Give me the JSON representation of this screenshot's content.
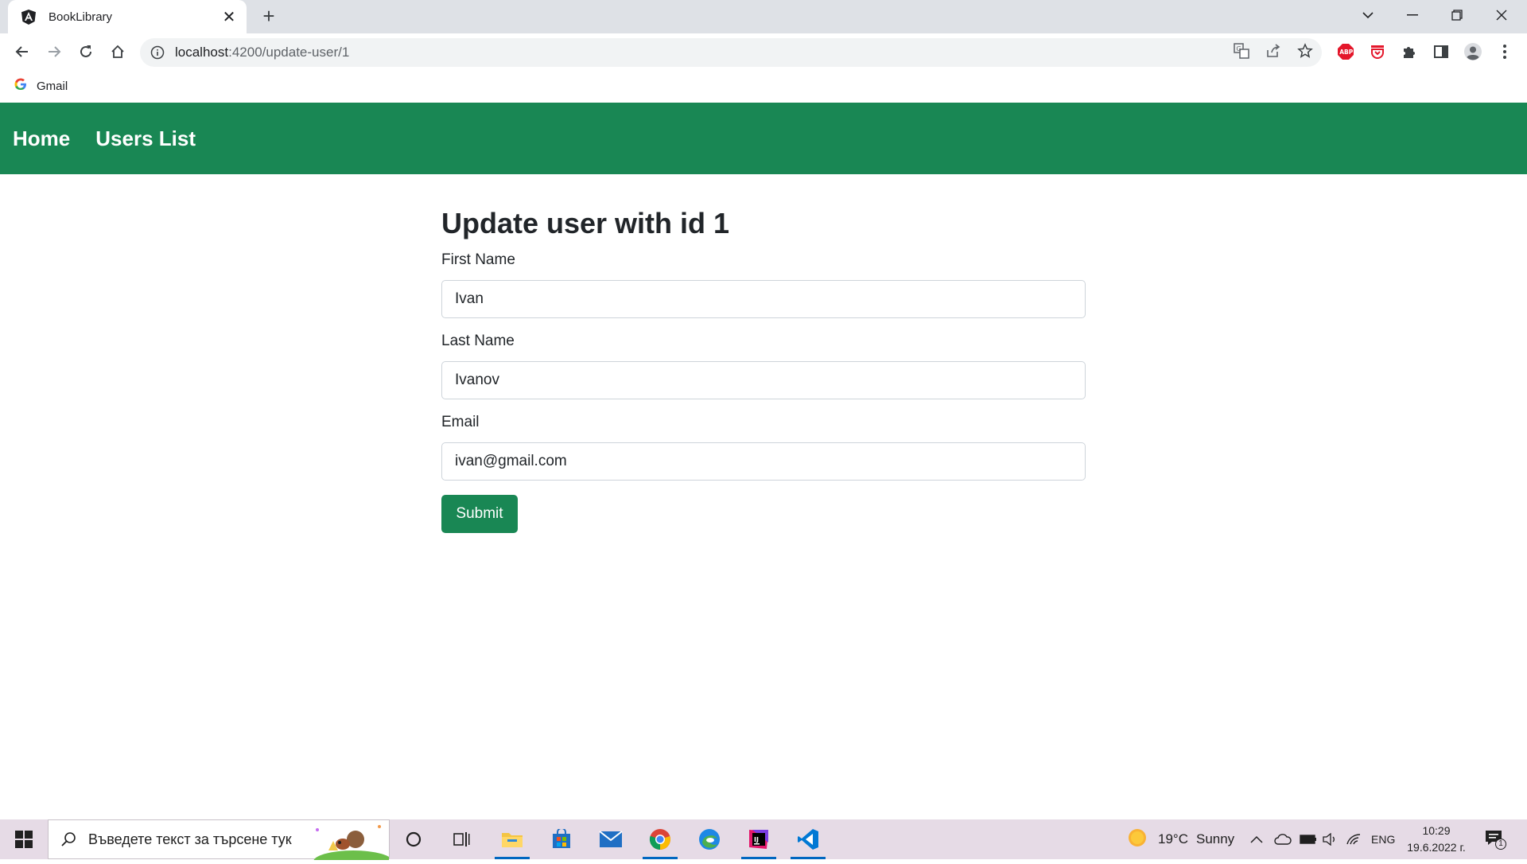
{
  "browser": {
    "tab": {
      "title": "BookLibrary",
      "close_glyph": "✕"
    },
    "newtab_glyph": "+",
    "address": {
      "host": "localhost",
      "path": ":4200/update-user/1"
    },
    "bookmarks": [
      {
        "label": "Gmail"
      }
    ]
  },
  "navbar": {
    "color": "#198754",
    "links": [
      {
        "label": "Home"
      },
      {
        "label": "Users List"
      }
    ]
  },
  "form": {
    "title": "Update user with id 1",
    "fields": [
      {
        "label": "First Name",
        "value": "Ivan"
      },
      {
        "label": "Last Name",
        "value": "Ivanov"
      },
      {
        "label": "Email",
        "value": "ivan@gmail.com"
      }
    ],
    "submit_label": "Submit"
  },
  "taskbar": {
    "search_placeholder": "Въведете текст за търсене тук",
    "weather": {
      "temp": "19°C",
      "condition": "Sunny"
    },
    "language": "ENG",
    "time": "10:29",
    "date": "19.6.2022 г.",
    "notification_count": "1"
  }
}
